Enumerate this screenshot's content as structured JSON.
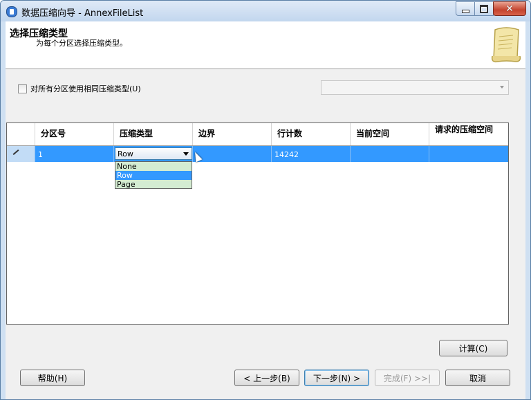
{
  "window": {
    "title": "数据压缩向导 - AnnexFileList"
  },
  "header": {
    "title": "选择压缩类型",
    "subtitle": "为每个分区选择压缩类型。"
  },
  "options": {
    "same_compression_label": "对所有分区使用相同压缩类型(U)",
    "same_compression_checked": false
  },
  "grid": {
    "columns": [
      "分区号",
      "压缩类型",
      "边界",
      "行计数",
      "当前空间",
      "请求的压缩空间"
    ],
    "rows": [
      {
        "partition": "1",
        "compression": "Row",
        "boundary": "",
        "row_count": "14242",
        "current_space": "",
        "requested_space": ""
      }
    ],
    "dropdown_options": [
      "None",
      "Row",
      "Page"
    ],
    "dropdown_selected": "Row"
  },
  "buttons": {
    "calculate": "计算(C)",
    "help": "帮助(H)",
    "back": "< 上一步(B)",
    "next": "下一步(N) >",
    "finish": "完成(F) >>|",
    "cancel": "取消"
  },
  "colors": {
    "selection": "#3399ff",
    "dropdown_bg": "#d4ecd2"
  }
}
